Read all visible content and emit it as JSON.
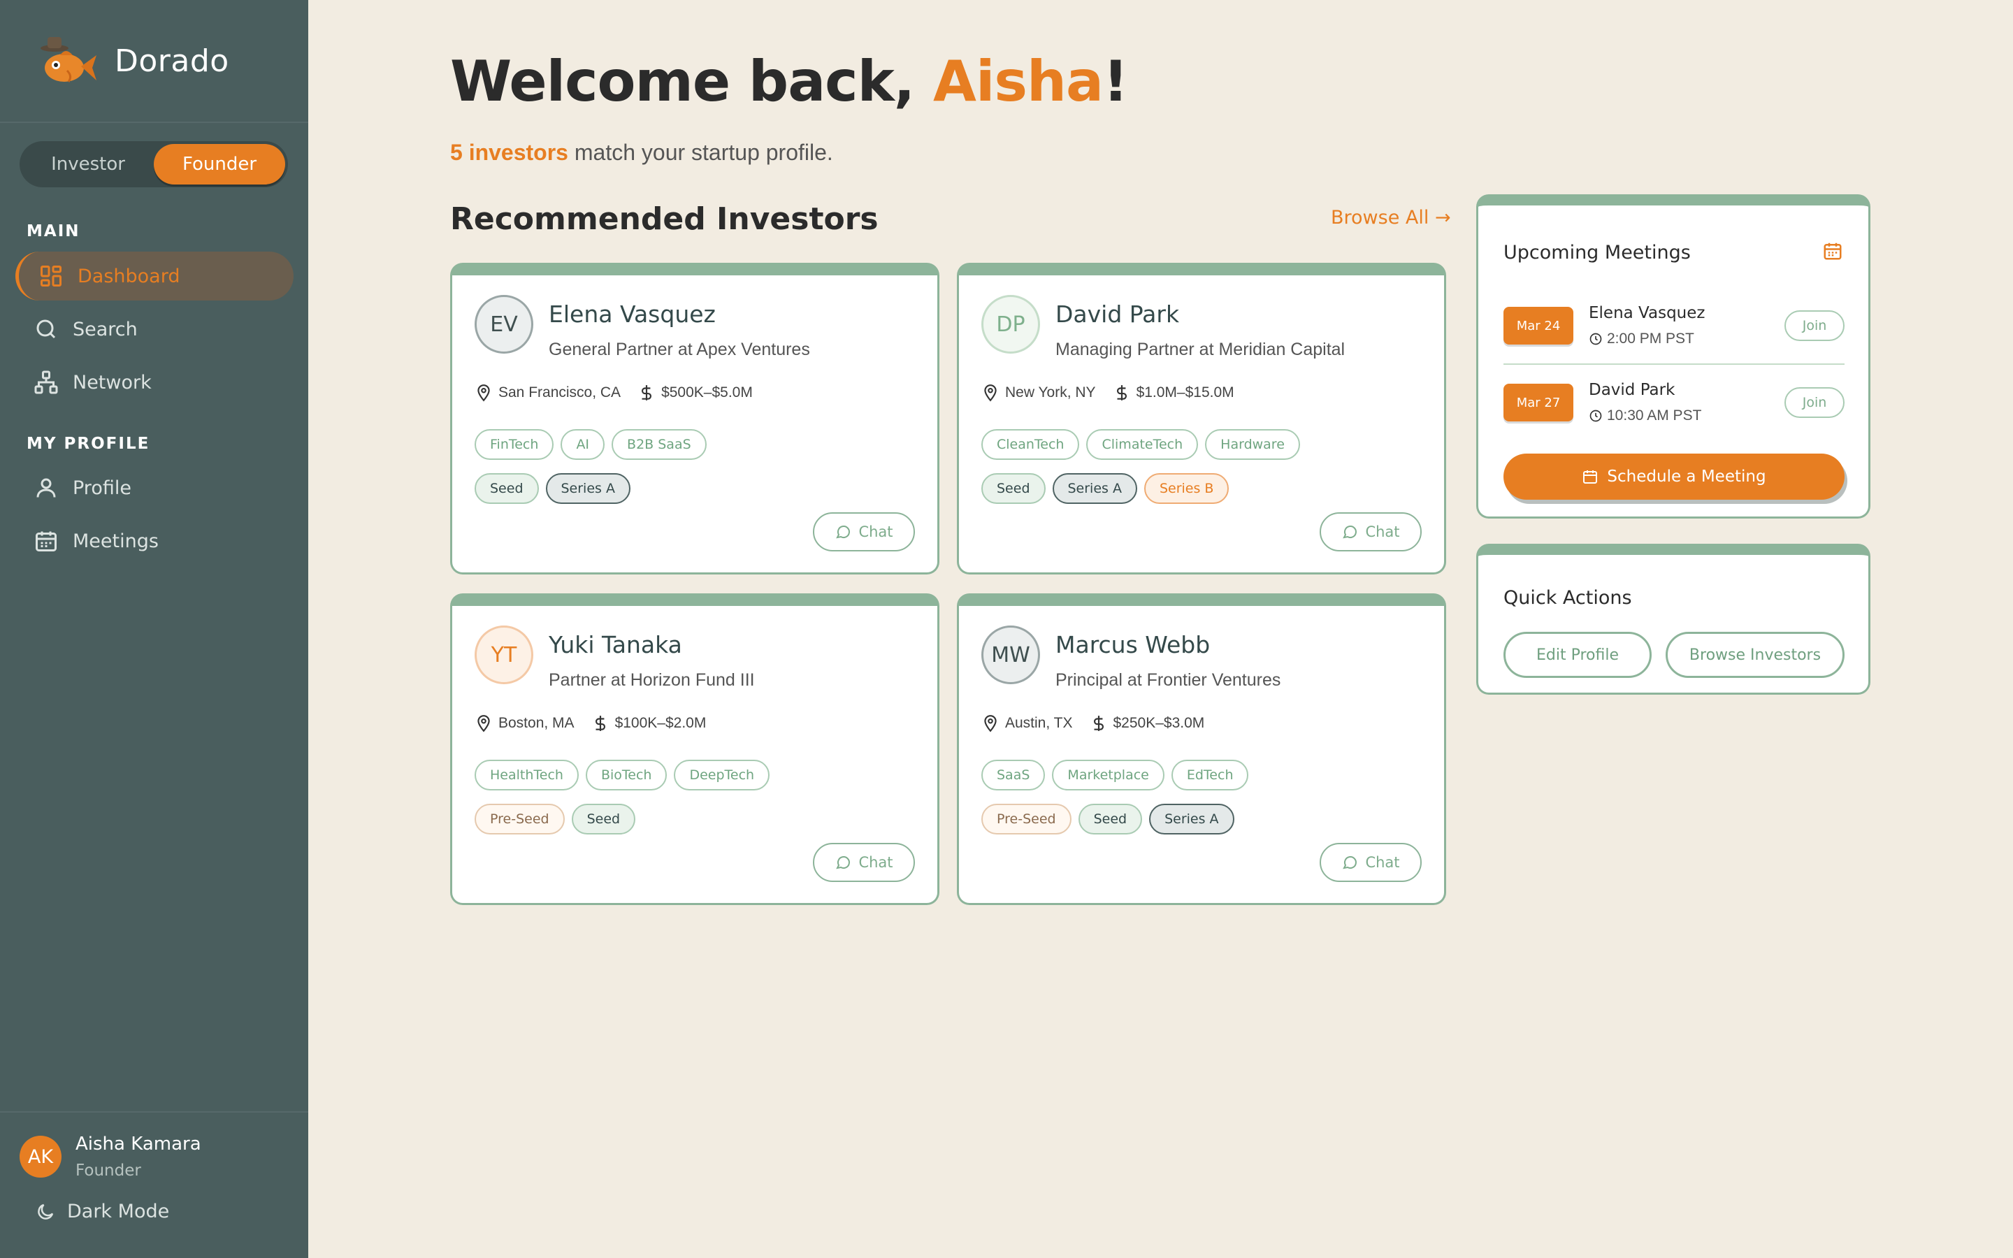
{
  "brand": {
    "name": "Dorado"
  },
  "role_toggle": {
    "investor": "Investor",
    "founder": "Founder",
    "active": "Founder"
  },
  "nav": {
    "main_heading": "MAIN",
    "dashboard": "Dashboard",
    "search": "Search",
    "network": "Network",
    "profile_heading": "MY PROFILE",
    "profile": "Profile",
    "meetings": "Meetings"
  },
  "user": {
    "initials": "AK",
    "name": "Aisha Kamara",
    "role": "Founder"
  },
  "dark_mode": "Dark Mode",
  "welcome": {
    "prefix": "Welcome back, ",
    "name": "Aisha",
    "suffix": "!"
  },
  "match": {
    "count": "5 investors",
    "text": " match your startup profile."
  },
  "section": {
    "title": "Recommended Investors",
    "browse_all": "Browse All →"
  },
  "investors": [
    {
      "initials": "EV",
      "name": "Elena Vasquez",
      "title": "General Partner at Apex Ventures",
      "location": "San Francisco, CA",
      "range": "$500K–$5.0M",
      "sectors": [
        "FinTech",
        "AI",
        "B2B SaaS"
      ],
      "stages": [
        "Seed",
        "Series A"
      ],
      "chat": "Chat"
    },
    {
      "initials": "DP",
      "name": "David Park",
      "title": "Managing Partner at Meridian Capital",
      "location": "New York, NY",
      "range": "$1.0M–$15.0M",
      "sectors": [
        "CleanTech",
        "ClimateTech",
        "Hardware"
      ],
      "stages": [
        "Seed",
        "Series A",
        "Series B"
      ],
      "chat": "Chat"
    },
    {
      "initials": "YT",
      "name": "Yuki Tanaka",
      "title": "Partner at Horizon Fund III",
      "location": "Boston, MA",
      "range": "$100K–$2.0M",
      "sectors": [
        "HealthTech",
        "BioTech",
        "DeepTech"
      ],
      "stages": [
        "Pre-Seed",
        "Seed"
      ],
      "chat": "Chat"
    },
    {
      "initials": "MW",
      "name": "Marcus Webb",
      "title": "Principal at Frontier Ventures",
      "location": "Austin, TX",
      "range": "$250K–$3.0M",
      "sectors": [
        "SaaS",
        "Marketplace",
        "EdTech"
      ],
      "stages": [
        "Pre-Seed",
        "Seed",
        "Series A"
      ],
      "chat": "Chat"
    }
  ],
  "meetings_panel": {
    "title": "Upcoming Meetings",
    "items": [
      {
        "date": "Mar 24",
        "name": "Elena Vasquez",
        "time": "2:00 PM PST",
        "join": "Join"
      },
      {
        "date": "Mar 27",
        "name": "David Park",
        "time": "10:30 AM PST",
        "join": "Join"
      }
    ],
    "schedule": "Schedule a Meeting"
  },
  "quick_actions": {
    "title": "Quick Actions",
    "edit_profile": "Edit Profile",
    "browse_investors": "Browse Investors"
  },
  "colors": {
    "accent": "#E77E22",
    "sidebar": "#4A5E5E",
    "card_border": "#8DB49A",
    "background": "#F2ECE1"
  }
}
